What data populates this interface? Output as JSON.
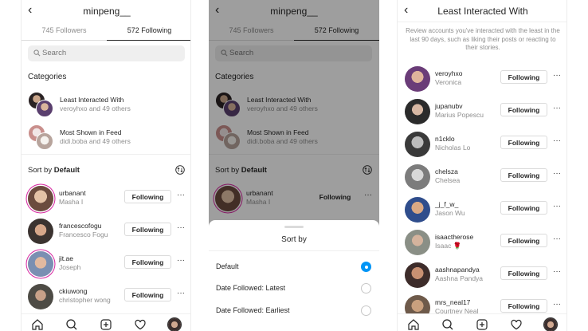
{
  "colors": {
    "accent": "#0095f6",
    "story_ring": "#d6249f",
    "muted": "#8e8e8e"
  },
  "profile": {
    "username": "minpeng__",
    "tabs": [
      {
        "label": "745 Followers"
      },
      {
        "label": "572 Following"
      }
    ],
    "search": {
      "placeholder": "Search"
    },
    "categories_title": "Categories",
    "categories": [
      {
        "name": "Least Interacted With",
        "sub": "veroyhxo and 49 others"
      },
      {
        "name": "Most Shown in Feed",
        "sub": "didi.boba and 49 others"
      }
    ],
    "sort": {
      "prefix": "Sort by",
      "value": "Default"
    },
    "following_label": "Following",
    "more_label": "···",
    "users": [
      {
        "username": "urbanant",
        "name": "Masha I"
      },
      {
        "username": "francescofogu",
        "name": "Francesco Fogu"
      },
      {
        "username": "jit.ae",
        "name": "Joseph"
      },
      {
        "username": "ckiuwong",
        "name": "christopher wong"
      }
    ]
  },
  "sort_sheet": {
    "title": "Sort by",
    "options": [
      {
        "label": "Default",
        "selected": true
      },
      {
        "label": "Date Followed: Latest",
        "selected": false
      },
      {
        "label": "Date Followed: Earliest",
        "selected": false
      }
    ]
  },
  "least": {
    "title": "Least Interacted With",
    "intro": "Review accounts you've interacted with the least in the last 90 days, such as liking their posts or reacting to their stories.",
    "users": [
      {
        "username": "veroyhxo",
        "name": "Veronica"
      },
      {
        "username": "jupanubv",
        "name": "Marius Popescu"
      },
      {
        "username": "n1cklo",
        "name": "Nicholas Lo"
      },
      {
        "username": "chelsza",
        "name": "Chelsea"
      },
      {
        "username": "_j_f_w_",
        "name": "Jason Wu"
      },
      {
        "username": "isaactherose",
        "name": "Isaac 🌹"
      },
      {
        "username": "aashnapandya",
        "name": "Aashna Pandya"
      },
      {
        "username": "mrs_neal17",
        "name": "Courtney Neal"
      }
    ]
  },
  "nav_icons": [
    "home-icon",
    "search-icon",
    "add-post-icon",
    "heart-icon",
    "profile-avatar"
  ]
}
